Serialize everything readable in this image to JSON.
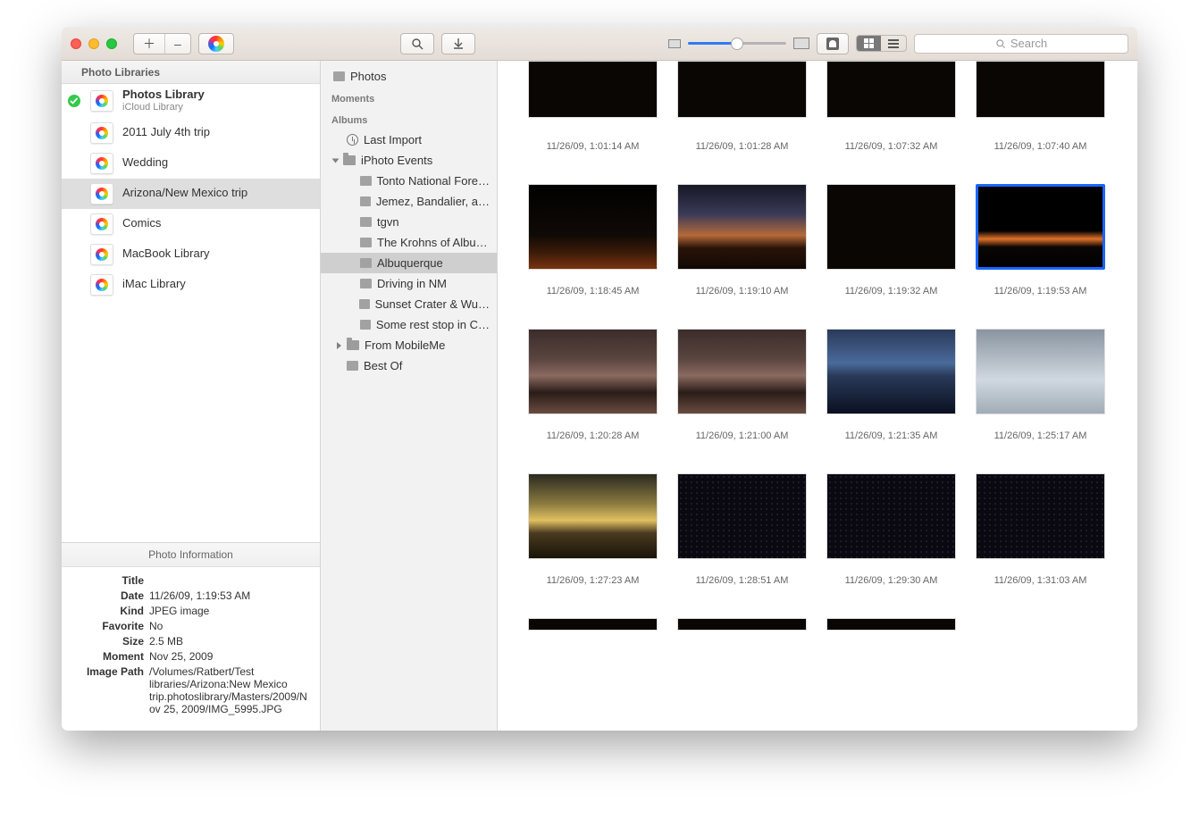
{
  "toolbar": {
    "search_placeholder": "Search"
  },
  "sidebar_left": {
    "header": "Photo Libraries",
    "libraries": [
      {
        "name": "Photos Library",
        "sub": "iCloud Library",
        "primary": true,
        "checked": true
      },
      {
        "name": "2011 July 4th trip"
      },
      {
        "name": "Wedding"
      },
      {
        "name": "Arizona/New Mexico trip",
        "selected": true
      },
      {
        "name": "Comics"
      },
      {
        "name": "MacBook Library"
      },
      {
        "name": "iMac Library"
      }
    ],
    "info": {
      "header": "Photo Information",
      "rows": [
        {
          "label": "Title",
          "value": ""
        },
        {
          "label": "Date",
          "value": "11/26/09, 1:19:53 AM"
        },
        {
          "label": "Kind",
          "value": "JPEG image"
        },
        {
          "label": "Favorite",
          "value": "No"
        },
        {
          "label": "Size",
          "value": "2.5 MB"
        },
        {
          "label": "Moment",
          "value": "Nov 25, 2009"
        },
        {
          "label": "Image Path",
          "value": "/Volumes/Ratbert/Test libraries/Arizona:New Mexico trip.photoslibrary/Masters/2009/Nov 25, 2009/IMG_5995.JPG"
        }
      ]
    }
  },
  "sidebar_mid": {
    "top_item": "Photos",
    "moments": "Moments",
    "albums_label": "Albums",
    "last_import": "Last Import",
    "events_folder": "iPhoto Events",
    "events": [
      "Tonto National Fore…",
      "Jemez, Bandalier, a…",
      "tgvn",
      "The Krohns of Albu…",
      "Albuquerque",
      "Driving in NM",
      "Sunset Crater & Wu…",
      "Some rest stop in C…"
    ],
    "from_mobileme": "From MobileMe",
    "best_of": "Best Of"
  },
  "grid": {
    "rows": [
      {
        "partial": true,
        "cells": [
          {
            "ts": "11/26/09, 1:01:14 AM",
            "art": "dark"
          },
          {
            "ts": "11/26/09, 1:01:28 AM",
            "art": "dark"
          },
          {
            "ts": "11/26/09, 1:07:32 AM",
            "art": "dark"
          },
          {
            "ts": "11/26/09, 1:07:40 AM",
            "art": "dark"
          }
        ]
      },
      {
        "cells": [
          {
            "ts": "11/26/09, 1:18:45 AM",
            "art": "sunset1"
          },
          {
            "ts": "11/26/09, 1:19:10 AM",
            "art": "sunset2"
          },
          {
            "ts": "11/26/09, 1:19:32 AM",
            "art": "dark"
          },
          {
            "ts": "11/26/09, 1:19:53 AM",
            "art": "orangeglow",
            "selected": true
          }
        ]
      },
      {
        "cells": [
          {
            "ts": "11/26/09, 1:20:28 AM",
            "art": "cityscape"
          },
          {
            "ts": "11/26/09, 1:21:00 AM",
            "art": "cityscape"
          },
          {
            "ts": "11/26/09, 1:21:35 AM",
            "art": "bluedusk"
          },
          {
            "ts": "11/26/09, 1:25:17 AM",
            "art": "snow"
          }
        ]
      },
      {
        "cells": [
          {
            "ts": "11/26/09, 1:27:23 AM",
            "art": "yellowdusk"
          },
          {
            "ts": "11/26/09, 1:28:51 AM",
            "art": "nightcity"
          },
          {
            "ts": "11/26/09, 1:29:30 AM",
            "art": "nightcity"
          },
          {
            "ts": "11/26/09, 1:31:03 AM",
            "art": "nightcity"
          }
        ]
      },
      {
        "partial_bottom": true,
        "cells": [
          {
            "ts": "",
            "art": "dark"
          },
          {
            "ts": "",
            "art": "dark"
          },
          {
            "ts": "",
            "art": "dark"
          }
        ]
      }
    ]
  }
}
